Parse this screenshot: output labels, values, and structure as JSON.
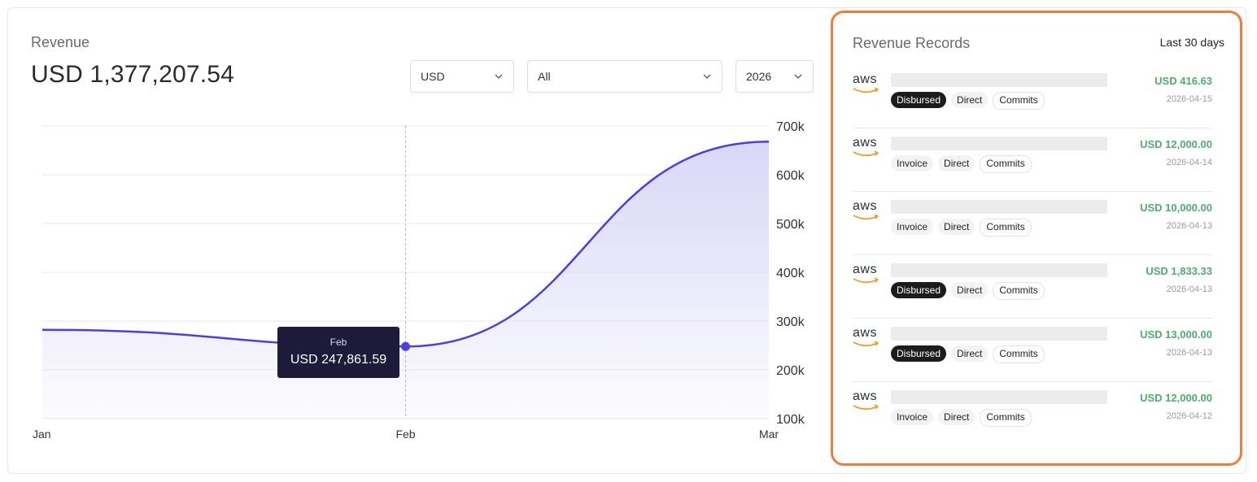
{
  "revenue": {
    "label": "Revenue",
    "total": "USD 1,377,207.54"
  },
  "filters": {
    "currency": "USD",
    "type": "All",
    "year": "2026"
  },
  "tooltip": {
    "month": "Feb",
    "value": "USD 247,861.59"
  },
  "chart_data": {
    "type": "area",
    "x": [
      "Jan",
      "Feb",
      "Mar"
    ],
    "values": [
      282000,
      247861.59,
      668000
    ],
    "ylim": [
      100000,
      700000
    ],
    "yticks": [
      "100k",
      "200k",
      "300k",
      "400k",
      "500k",
      "600k",
      "700k"
    ],
    "grid": true,
    "line_color": "#4a3fe4",
    "fill_color": "#d9d7f7",
    "highlight_index": 1
  },
  "records": {
    "title": "Revenue Records",
    "range": "Last 30 days",
    "items": [
      {
        "logo": "aws",
        "tags": [
          "Disbursed",
          "Direct",
          "Commits"
        ],
        "amount": "USD 416.63",
        "date": "2026-04-15"
      },
      {
        "logo": "aws",
        "tags": [
          "Invoice",
          "Direct",
          "Commits"
        ],
        "amount": "USD 12,000.00",
        "date": "2026-04-14"
      },
      {
        "logo": "aws",
        "tags": [
          "Invoice",
          "Direct",
          "Commits"
        ],
        "amount": "USD 10,000.00",
        "date": "2026-04-13"
      },
      {
        "logo": "aws",
        "tags": [
          "Disbursed",
          "Direct",
          "Commits"
        ],
        "amount": "USD 1,833.33",
        "date": "2026-04-13"
      },
      {
        "logo": "aws",
        "tags": [
          "Disbursed",
          "Direct",
          "Commits"
        ],
        "amount": "USD 13,000.00",
        "date": "2026-04-13"
      },
      {
        "logo": "aws",
        "tags": [
          "Invoice",
          "Direct",
          "Commits"
        ],
        "amount": "USD 12,000.00",
        "date": "2026-04-12"
      }
    ]
  },
  "colors": {
    "accent": "#4a3fe4",
    "positive": "#4caf6e",
    "highlight_border": "#ee7d3b"
  }
}
